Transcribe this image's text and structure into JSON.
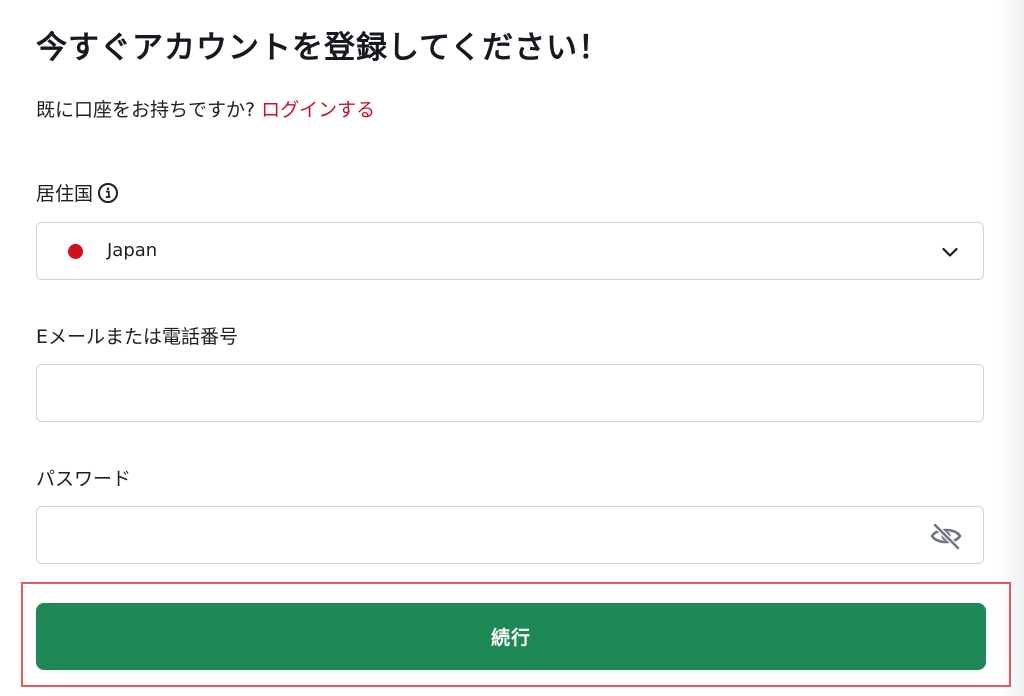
{
  "header": {
    "title": "今すぐアカウントを登録してください！",
    "login_prompt": "既に口座をお持ちですか? ",
    "login_link": "ログインする"
  },
  "form": {
    "residence": {
      "label": "居住国",
      "info_icon": "info-circle-icon",
      "selected_value": "Japan",
      "flag_color": "#d0101e",
      "dropdown_icon": "chevron-down-icon"
    },
    "email_or_phone": {
      "label": "Eメールまたは電話番号",
      "value": "",
      "placeholder": ""
    },
    "password": {
      "label": "パスワード",
      "value": "",
      "placeholder": "",
      "visibility_icon": "eye-slash-icon"
    },
    "submit": {
      "label": "続行",
      "color": "#1d8755"
    }
  },
  "colors": {
    "link": "#c8102e",
    "highlight_frame": "#e8585f"
  }
}
